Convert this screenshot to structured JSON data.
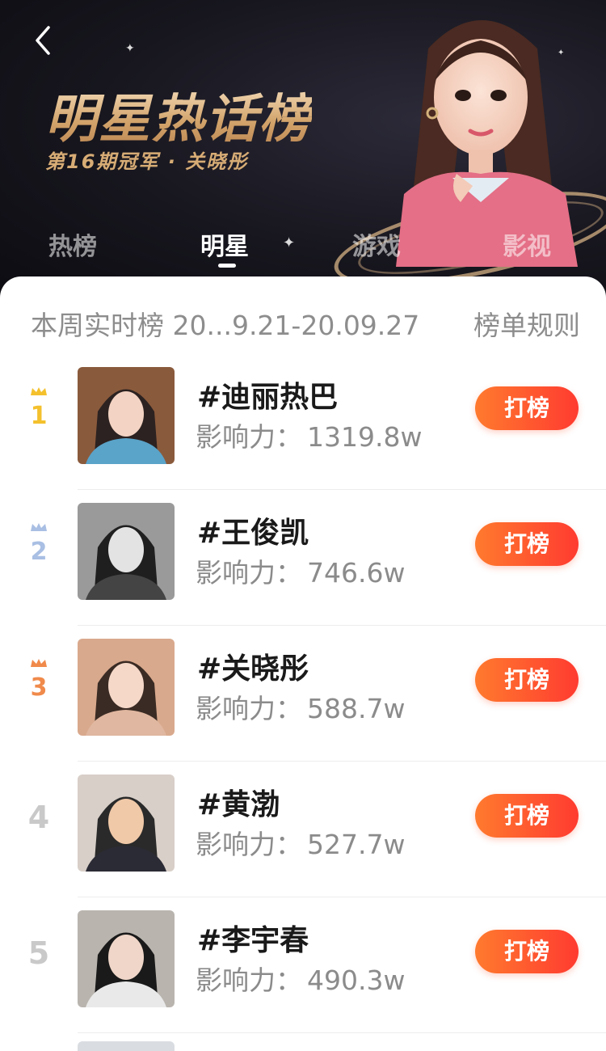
{
  "header": {
    "back_icon": "chevron-left-icon",
    "title": "明星热话榜",
    "subtitle": "第16期冠军 · 关晓彤",
    "tabs": [
      {
        "label": "热榜",
        "active": false
      },
      {
        "label": "明星",
        "active": true
      },
      {
        "label": "游戏",
        "active": false
      },
      {
        "label": "影视",
        "active": false
      }
    ]
  },
  "board": {
    "period_label": "本周实时榜 20...9.21-20.09.27",
    "rules_label": "榜单规则",
    "influence_prefix": "影响力：",
    "vote_label": "打榜"
  },
  "items": [
    {
      "rank": "1",
      "name": "#迪丽热巴",
      "influence": "1319.8w",
      "crown_color": "#f4c12d"
    },
    {
      "rank": "2",
      "name": "#王俊凯",
      "influence": "746.6w",
      "crown_color": "#a9bfe3"
    },
    {
      "rank": "3",
      "name": "#关晓彤",
      "influence": "588.7w",
      "crown_color": "#f08a4b"
    },
    {
      "rank": "4",
      "name": "#黄渤",
      "influence": "527.7w",
      "crown_color": ""
    },
    {
      "rank": "5",
      "name": "#李宇春",
      "influence": "490.3w",
      "crown_color": ""
    }
  ],
  "colors": {
    "accent_gradient_start": "#ff7a2e",
    "accent_gradient_end": "#ff3b30",
    "banner_bg": "#17161e",
    "title_gold": "#d7ac75"
  }
}
